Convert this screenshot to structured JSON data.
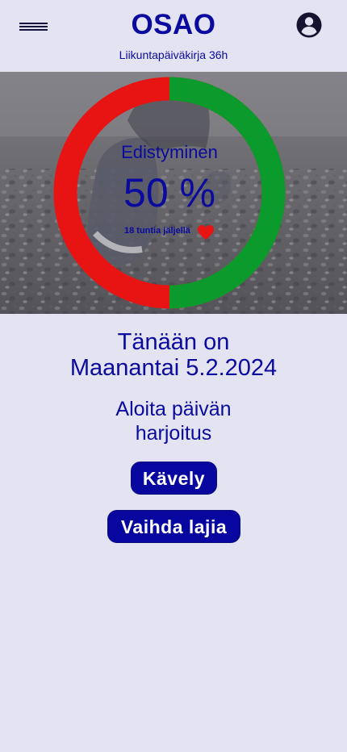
{
  "header": {
    "brand": "OSAO",
    "subtitle": "Liikuntapäiväkirja 36h",
    "menu_icon": "hamburger-menu-icon",
    "account_icon": "account-circle-icon"
  },
  "progress": {
    "label": "Edistyminen",
    "value_text": "50 %",
    "fraction": 0.5,
    "remaining_text": "18 tuntia jäljellä",
    "heart_icon": "heart-icon",
    "colors": {
      "done": "#0b9b2c",
      "remaining": "#e81313"
    }
  },
  "today": {
    "line1": "Tänään on",
    "line2": "Maanantai 5.2.2024"
  },
  "start": {
    "line1": "Aloita päivän",
    "line2": "harjoitus"
  },
  "buttons": {
    "activity": "Kävely",
    "change": "Vaihda lajia"
  },
  "colors": {
    "background": "#e3e3f1",
    "accent": "#0a0a9e"
  }
}
